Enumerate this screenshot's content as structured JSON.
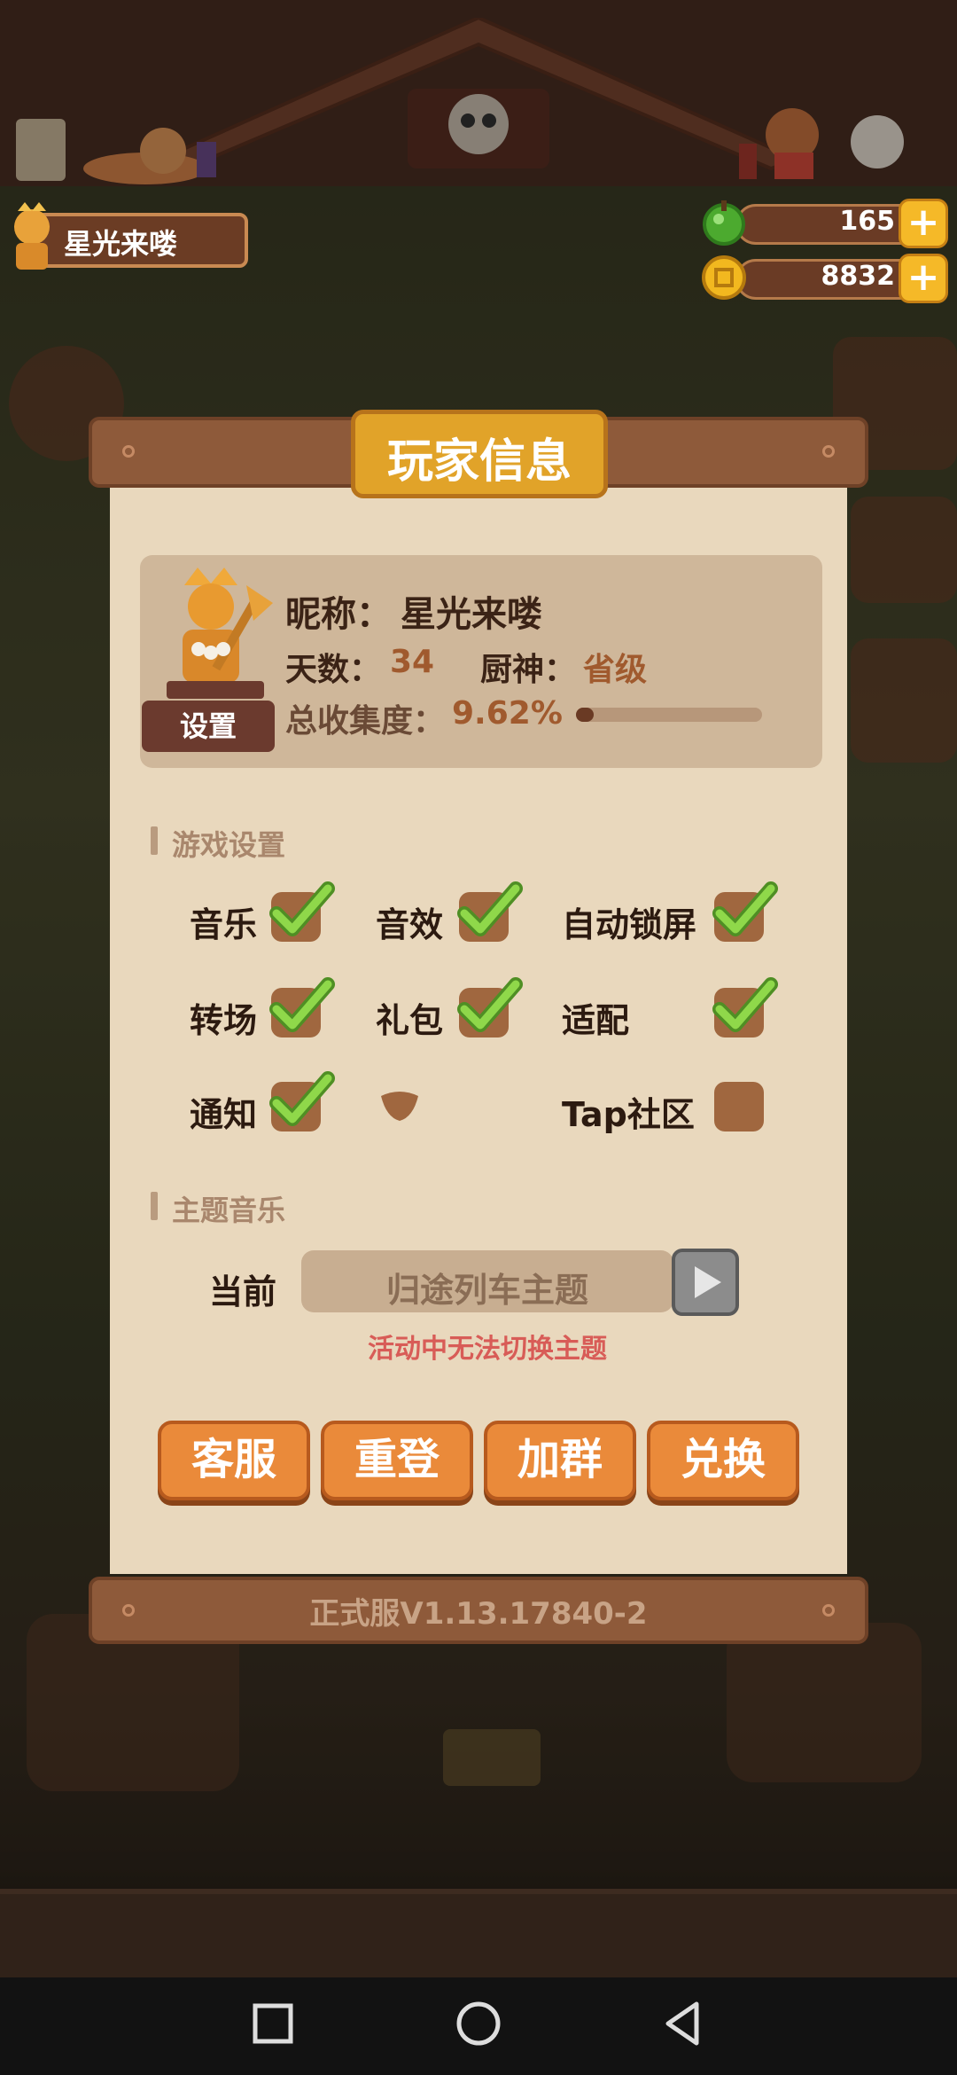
{
  "header": {
    "player_name": "星光来喽",
    "currencies": [
      {
        "icon": "green-gem-icon",
        "value": "165"
      },
      {
        "icon": "gold-coin-icon",
        "value": "8832"
      }
    ]
  },
  "dialog": {
    "title": "玩家信息",
    "profile": {
      "nickname_label": "昵称：",
      "nickname": "星光来喽",
      "days_label": "天数：",
      "days": "34",
      "chef_label": "厨神：",
      "chef_rank": "省级",
      "collection_label": "总收集度：",
      "collection": "9.62%",
      "collection_fraction": 0.0962,
      "settings_button": "设置"
    },
    "game_settings": {
      "title": "游戏设置",
      "options": [
        {
          "label": "音乐",
          "checked": true
        },
        {
          "label": "音效",
          "checked": true
        },
        {
          "label": "自动锁屏",
          "checked": true
        },
        {
          "label": "转场",
          "checked": true
        },
        {
          "label": "礼包",
          "checked": true
        },
        {
          "label": "适配",
          "checked": true
        },
        {
          "label": "通知",
          "checked": true
        },
        {
          "label": "Tap社区",
          "checked": false
        }
      ]
    },
    "theme_music": {
      "title": "主题音乐",
      "current_label": "当前",
      "current_theme": "归途列车主题",
      "warning": "活动中无法切换主题"
    },
    "buttons": {
      "support": "客服",
      "relogin": "重登",
      "join_group": "加群",
      "redeem": "兑换"
    },
    "version": "正式服V1.13.17840-2"
  },
  "colors": {
    "accent_orange": "#ea8a3a",
    "title_gold": "#e1a329",
    "warning_red": "#d85c57",
    "check_green": "#7cc63a"
  }
}
